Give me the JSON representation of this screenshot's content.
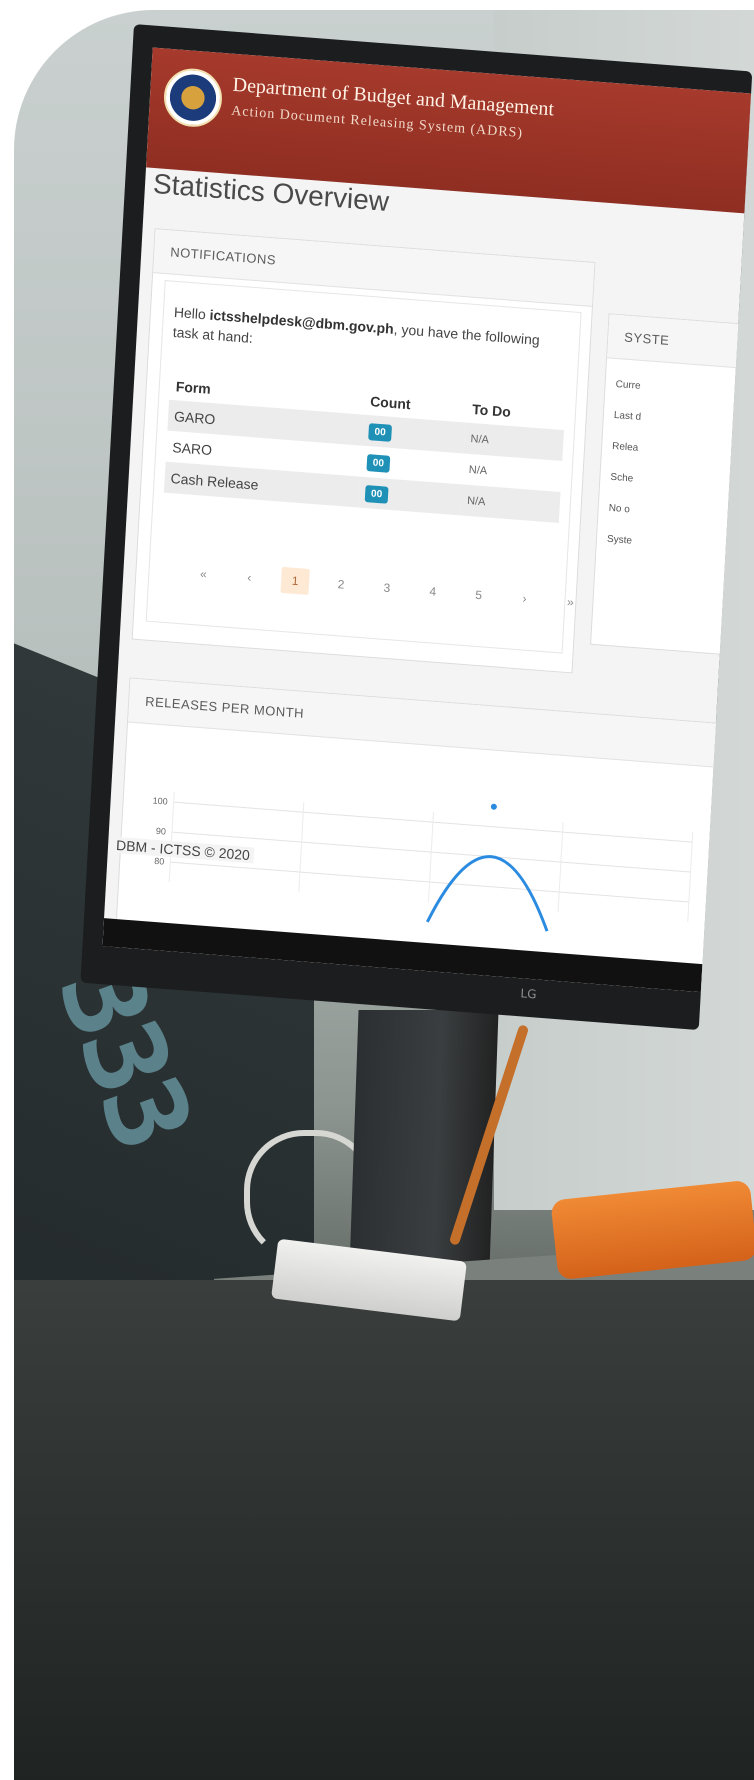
{
  "app": {
    "org_name": "Department of Budget and Management",
    "system_name": "Action Document Releasing System (ADRS)"
  },
  "page": {
    "title": "Statistics Overview"
  },
  "notifications": {
    "heading": "NOTIFICATIONS",
    "greeting_prefix": "Hello ",
    "user": "ictsshelpdesk@dbm.gov.ph",
    "greeting_suffix": ", you have the following task at hand:",
    "columns": {
      "form": "Form",
      "count": "Count",
      "todo": "To Do"
    },
    "rows": [
      {
        "form": "GARO",
        "count": "00",
        "todo": "N/A"
      },
      {
        "form": "SARO",
        "count": "00",
        "todo": "N/A"
      },
      {
        "form": "Cash Release",
        "count": "00",
        "todo": "N/A"
      }
    ],
    "pagination": {
      "first": "«",
      "prev": "‹",
      "pages": [
        "1",
        "2",
        "3",
        "4",
        "5"
      ],
      "active": "1",
      "next": "›",
      "last": "»"
    }
  },
  "system_panel": {
    "heading": "SYSTE",
    "items": [
      "Curre",
      "Last d",
      "Relea",
      "Sche",
      "No o",
      "Syste"
    ]
  },
  "releases": {
    "heading": "RELEASES PER MONTH"
  },
  "chart_data": {
    "type": "line",
    "title": "",
    "ylim": [
      80,
      100
    ],
    "yticks": [
      "100",
      "90",
      "80"
    ],
    "series": [
      {
        "values": [
          80,
          100,
          80
        ]
      }
    ]
  },
  "footer": {
    "text": "DBM - ICTSS © 2020"
  },
  "monitor": {
    "brand": "LG"
  },
  "scene": {
    "clock_digits": "333"
  },
  "colors": {
    "header_red": "#a63a2c",
    "badge_blue": "#1f91b7",
    "active_page": "#fde9d4",
    "line_blue": "#2b8be0"
  }
}
